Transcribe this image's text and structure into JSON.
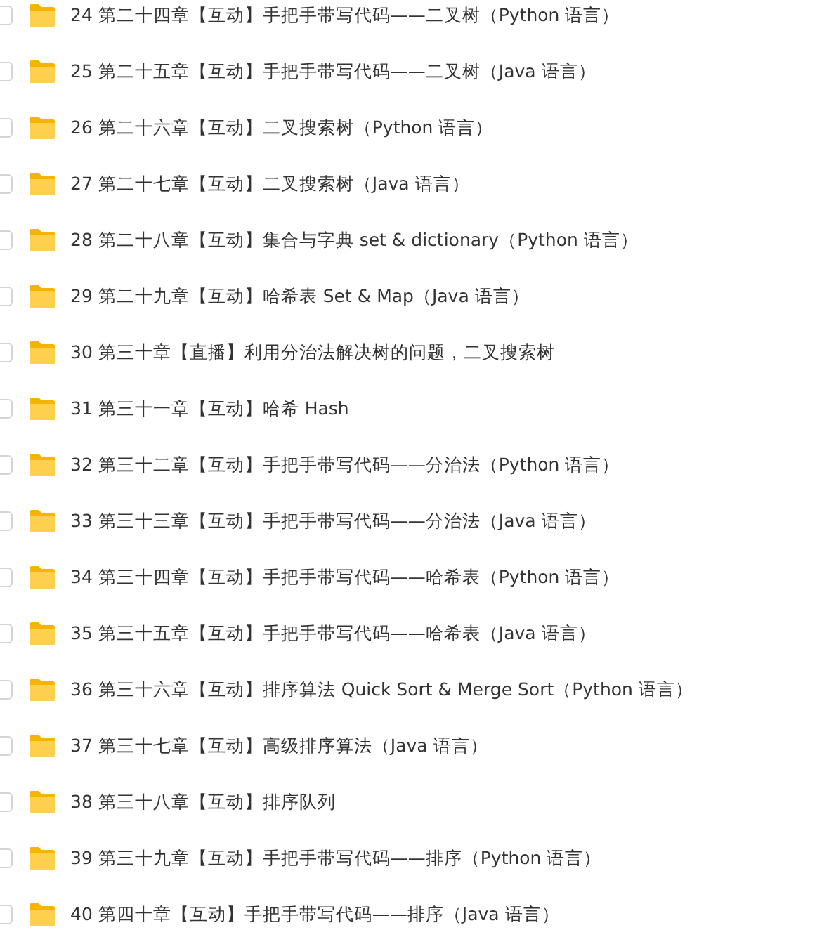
{
  "folders": [
    {
      "name": "24 第二十四章【互动】手把手带写代码——二叉树（Python 语言）",
      "checked": false
    },
    {
      "name": "25 第二十五章【互动】手把手带写代码——二叉树（Java 语言）",
      "checked": false
    },
    {
      "name": "26 第二十六章【互动】二叉搜索树（Python 语言）",
      "checked": false
    },
    {
      "name": "27 第二十七章【互动】二叉搜索树（Java 语言）",
      "checked": false
    },
    {
      "name": "28 第二十八章【互动】集合与字典 set & dictionary（Python 语言）",
      "checked": false
    },
    {
      "name": "29 第二十九章【互动】哈希表 Set & Map（Java 语言）",
      "checked": false
    },
    {
      "name": "30 第三十章【直播】利用分治法解决树的问题，二叉搜索树",
      "checked": false
    },
    {
      "name": "31 第三十一章【互动】哈希 Hash",
      "checked": false
    },
    {
      "name": "32 第三十二章【互动】手把手带写代码——分治法（Python 语言）",
      "checked": false
    },
    {
      "name": "33 第三十三章【互动】手把手带写代码——分治法（Java 语言）",
      "checked": false
    },
    {
      "name": "34 第三十四章【互动】手把手带写代码——哈希表（Python 语言）",
      "checked": false
    },
    {
      "name": "35 第三十五章【互动】手把手带写代码——哈希表（Java 语言）",
      "checked": false
    },
    {
      "name": "36 第三十六章【互动】排序算法 Quick Sort & Merge Sort（Python 语言）",
      "checked": false
    },
    {
      "name": "37 第三十七章【互动】高级排序算法（Java 语言）",
      "checked": false
    },
    {
      "name": "38 第三十八章【互动】排序队列",
      "checked": false
    },
    {
      "name": "39 第三十九章【互动】手把手带写代码——排序（Python 语言）",
      "checked": false
    },
    {
      "name": "40 第四十章【互动】手把手带写代码——排序（Java 语言）",
      "checked": false
    }
  ]
}
